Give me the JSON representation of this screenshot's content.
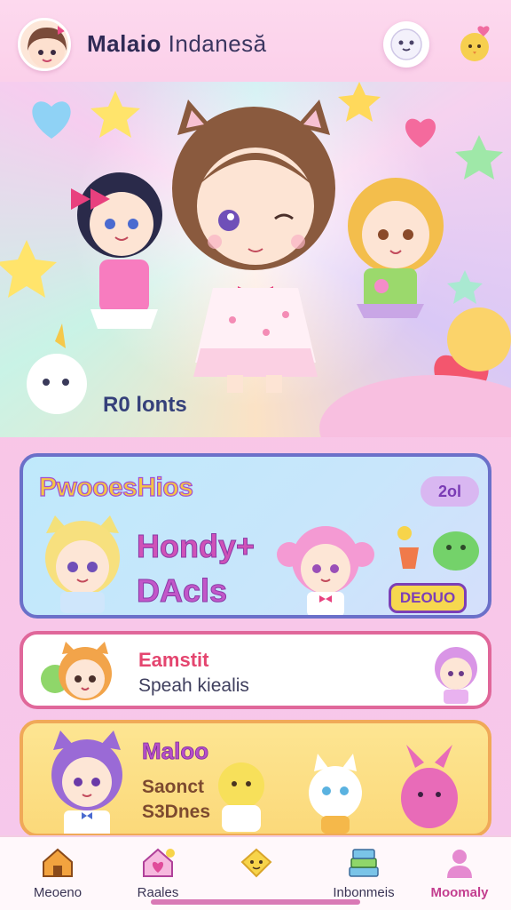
{
  "header": {
    "title_bold": "Malaio",
    "title_light": "Indanesă"
  },
  "hero": {
    "label": "R0 lonts"
  },
  "promo_card": {
    "title": "PwooesHios",
    "badge": "2ol",
    "line1": "Hondy+",
    "line2": "DAcls",
    "tag": "DEOUO"
  },
  "list_card": {
    "title": "Eamstit",
    "subtitle": "Speah kiealis"
  },
  "yellow_card": {
    "title": "Maloo",
    "line1": "Saonct",
    "line2": "S3Dnes"
  },
  "nav": {
    "items": [
      {
        "label": "Meoeno",
        "icon": "house-icon"
      },
      {
        "label": "Raales",
        "icon": "home-heart-icon"
      },
      {
        "label": "",
        "icon": "star-face-icon"
      },
      {
        "label": "Inbonmeis",
        "icon": "books-icon"
      },
      {
        "label": "Moomaly",
        "icon": "profile-icon"
      }
    ],
    "active_index": 4
  },
  "colors": {
    "accent_pink": "#c33e8f",
    "promo_border": "#6b70c9",
    "list_border": "#e0679a",
    "yellow_border": "#f0a958"
  }
}
